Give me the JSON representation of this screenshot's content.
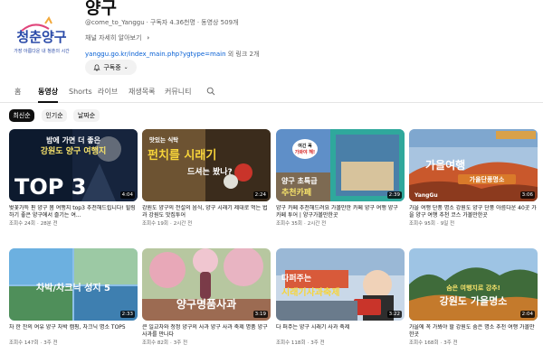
{
  "channel": {
    "name": "양구",
    "handle": "@come_to_Yanggu",
    "subscribers": "구독자 4.36천명",
    "video_count": "동영상 509개",
    "meta_dot": "·",
    "description_label": "채널 자세히 알아보기",
    "link_url": "yanggu.go.kr/index_main.php?ygtype=main",
    "link_more": "외 링크 2개",
    "subscribe_label": "구독중",
    "avatar_text_line1": "청춘양구",
    "avatar_text_line2": "가장 아름다운 내 청춘의 시간"
  },
  "tabs": [
    {
      "label": "홈"
    },
    {
      "label": "동영상"
    },
    {
      "label": "Shorts"
    },
    {
      "label": "라이브"
    },
    {
      "label": "재생목록"
    },
    {
      "label": "커뮤니티"
    }
  ],
  "filters": [
    {
      "label": "최신순"
    },
    {
      "label": "인기순"
    },
    {
      "label": "날짜순"
    }
  ],
  "videos": [
    {
      "duration": "4:04",
      "title": "벚꽃가득 핀 양구 봄 여행지 top3 추천해드립니다! 힐링하기 좋은 양구에서 즐기는 여...",
      "views": "조회수 24회",
      "age": "28분 전",
      "overlay": [
        "밤에 가면 더 좋은",
        "강원도 양구 여행지",
        "TOP 3"
      ]
    },
    {
      "duration": "2:24",
      "title": "강원도 양구의 전설의 음식, 양구 시래기 제대로 먹는 법과 강원도 맛집투어",
      "views": "조회수 19회",
      "age": "2시간 전",
      "overlay": [
        "맛있는 식탁",
        "펀치를 시래기",
        "드셔는 봤나?"
      ]
    },
    {
      "duration": "2:39",
      "title": "양구 카페 추천해드려요 가볼만한 카페 양구 여행 양구 카페 투어 | 양구가볼만한곳",
      "views": "조회수 35회",
      "age": "2시간 전",
      "overlay": [
        "여긴 꼭",
        "가봐야 해!",
        "양구 초특급",
        "추천카페"
      ]
    },
    {
      "duration": "3:06",
      "title": "가을 여행 단풍 명소 강원도 양구 단풍 아름다운 40곳 가을 양구 여행 추천 코스 가볼만한곳",
      "views": "조회수 95회",
      "age": "9일 전",
      "overlay": [
        "가을여행",
        "가을단풍명소",
        "YangGu"
      ]
    },
    {
      "duration": "2:33",
      "title": "차 한 잔의 여유 양구 차박 캠핑, 차크닉 명소 TOP5",
      "views": "조회수 147회",
      "age": "3주 전",
      "overlay": [
        "차박/차크닉 성지 5"
      ]
    },
    {
      "duration": "3:19",
      "title": "큰 일교차와 청정 양구의 사과 양구 사과 축제 명품 양구 사과를 만나다",
      "views": "조회수 82회",
      "age": "3주 전",
      "overlay": [
        "양구명품사과"
      ]
    },
    {
      "duration": "3:22",
      "title": "다 퍼주는 양구 시래기 사과 축제",
      "views": "조회수 118회",
      "age": "3주 전",
      "overlay": [
        "다퍼주는",
        "시래기사과축제"
      ]
    },
    {
      "duration": "2:04",
      "title": "가을에 꼭 가봐야 할 강원도 숨은 명소 추천 여행 가볼만한곳",
      "views": "조회수 168회",
      "age": "3주 전",
      "overlay": [
        "숨은 여행지로 강추!",
        "강원도 가을명소"
      ]
    }
  ],
  "colors": {
    "link": "#065fd4",
    "text": "#0f0f0f",
    "muted": "#606060",
    "chip": "#f2f2f2"
  }
}
